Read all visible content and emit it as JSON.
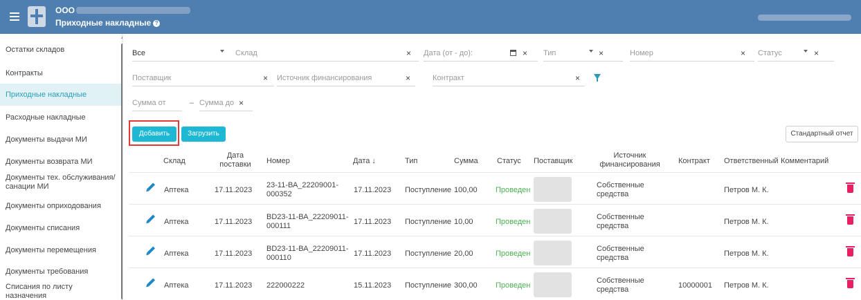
{
  "header": {
    "org": "ООО",
    "title": "Приходные накладные"
  },
  "sidebar": {
    "items": [
      {
        "label": "Остатки складов"
      },
      {
        "label": "Контракты"
      },
      {
        "label": "Приходные накладные",
        "active": true
      },
      {
        "label": "Расходные накладные"
      },
      {
        "label": "Документы выдачи МИ"
      },
      {
        "label": "Документы возврата МИ"
      },
      {
        "label": "Документы тех. обслуживания/санации МИ"
      },
      {
        "label": "Документы оприходования"
      },
      {
        "label": "Документы списания"
      },
      {
        "label": "Документы перемещения"
      },
      {
        "label": "Документы требования"
      },
      {
        "label": "Списания по листу назначения"
      }
    ]
  },
  "filters": {
    "all": "Все",
    "warehouse": "Склад",
    "date_range": "Дата (от - до):",
    "type": "Тип",
    "number": "Номер",
    "status": "Статус",
    "supplier": "Поставщик",
    "funding_source": "Источник финансирования",
    "contract": "Контракт",
    "sum_from": "Сумма от",
    "dash": "–",
    "sum_to": "Сумма до"
  },
  "toolbar": {
    "add_label": "Добавить",
    "upload_label": "Загрузить",
    "report_label": "Стандартный отчет"
  },
  "table": {
    "columns": {
      "warehouse": "Склад",
      "delivery_date": "Дата поставки",
      "number": "Номер",
      "date": "Дата ↓",
      "type": "Тип",
      "sum": "Сумма",
      "status": "Статус",
      "supplier": "Поставщик",
      "funding_source": "Источник финансирования",
      "contract": "Контракт",
      "responsible": "Ответственный",
      "comment": "Комментарий"
    },
    "rows": [
      {
        "warehouse": "Аптека",
        "delivery_date": "17.11.2023",
        "number": "23-11-ВА_22209001-000352",
        "date": "17.11.2023",
        "type": "Поступление",
        "sum": "100,00",
        "status": "Проведен",
        "funding_source": "Собственные средства",
        "contract": "",
        "responsible": "Петров М. К."
      },
      {
        "warehouse": "Аптека",
        "delivery_date": "17.11.2023",
        "number": "BD23-11-ВА_22209011-000111",
        "date": "17.11.2023",
        "type": "Поступление",
        "sum": "10,00",
        "status": "Проведен",
        "funding_source": "Собственные средства",
        "contract": "",
        "responsible": "Петров М. К."
      },
      {
        "warehouse": "Аптека",
        "delivery_date": "17.11.2023",
        "number": "BD23-11-ВА_22209011-000110",
        "date": "17.11.2023",
        "type": "Поступление",
        "sum": "20,00",
        "status": "Проведен",
        "funding_source": "Собственные средства",
        "contract": "",
        "responsible": "Петров М. К."
      },
      {
        "warehouse": "Аптека",
        "delivery_date": "17.11.2023",
        "number": "222000222",
        "date": "15.11.2023",
        "type": "Поступление",
        "sum": "300,00",
        "status": "Проведен",
        "funding_source": "Собственные средства",
        "contract": "10000001",
        "responsible": "Петров М. К."
      }
    ]
  },
  "colors": {
    "header": "#4f7fb1",
    "accent": "#1eb8d5",
    "status_ok": "#4caf50",
    "delete": "#e91e63",
    "highlight_frame": "#e53935"
  }
}
